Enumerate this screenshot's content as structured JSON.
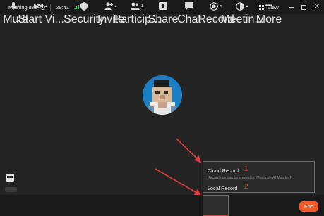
{
  "window": {
    "title": "Meeting Info",
    "timer": "29:41",
    "view_label": "View"
  },
  "record_menu": {
    "cloud_title": "Cloud Record",
    "cloud_sub": "Recordings can be viewed in [Meeting - AI Minutes]",
    "local_title": "Local Record",
    "marker_1": "1",
    "marker_2": "2"
  },
  "toolbar": {
    "mute": "Mute",
    "start_video": "Start Vi...",
    "security": "Security",
    "invite": "Invite",
    "participants": "Particip...",
    "participants_count": "1",
    "share": "Share",
    "chat": "Chat",
    "record": "Record",
    "meeting": "Meetin...",
    "more": "More",
    "end": "End"
  },
  "colors": {
    "accent_red": "#e03b3b",
    "end_orange": "#ef5b2b",
    "avatar_blue": "#1c7fc4",
    "signal_green": "#3bbf5a"
  }
}
